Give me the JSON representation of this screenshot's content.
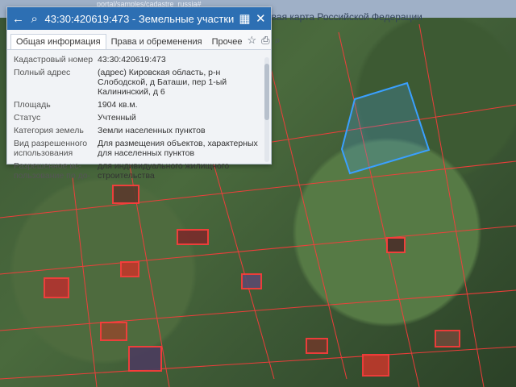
{
  "browser": {
    "url_fragment": "portal/samples/cadastre_russia#"
  },
  "map": {
    "title_fragment": "овая карта Российской Федерации",
    "colors": {
      "parcel_border": "#ff3b3b",
      "selected_parcel": "#3aa0ff"
    }
  },
  "panel": {
    "header": {
      "title": "43:30:420619:473 - Земельные участки"
    },
    "tabs": [
      {
        "label": "Общая информация"
      },
      {
        "label": "Права и обременения"
      },
      {
        "label": "Прочее"
      }
    ],
    "tools": {
      "star": "☆",
      "print": "⎙",
      "zoom": "⌕"
    },
    "fields": [
      {
        "label": "Кадастровый номер",
        "value": "43:30:420619:473"
      },
      {
        "label": "Полный адрес",
        "value": "(адрес) Кировская область, р-н Слободской, д Баташи, пер 1-ый Калининский, д 6"
      },
      {
        "label": "Площадь",
        "value": "1904 кв.м."
      },
      {
        "label": "Статус",
        "value": "Учтенный"
      },
      {
        "label": "Категория земель",
        "value": "Земли населенных пунктов"
      },
      {
        "label": "Вид разрешенного использования",
        "value": "Для размещения объектов, характерных для населенных пунктов"
      },
      {
        "label": "Разрешенное ис-пользование по до-",
        "value": "для индивидуального жилищного строительства"
      }
    ]
  }
}
